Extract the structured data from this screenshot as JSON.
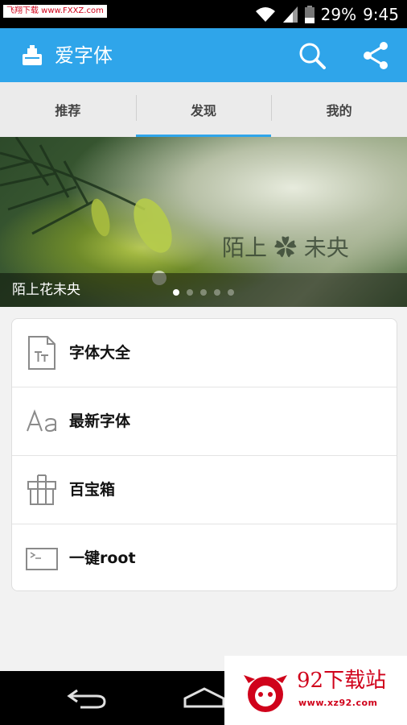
{
  "status_bar": {
    "watermark": "飞翔下载 www.FXXZ.com",
    "battery": "29%",
    "time": "9:45",
    "icons": [
      "wifi-icon",
      "signal-icon",
      "battery-icon"
    ]
  },
  "app_bar": {
    "title": "爱字体",
    "color": "#2fa5ea",
    "actions": [
      "search-icon",
      "share-icon"
    ]
  },
  "tabs": [
    {
      "label": "推荐",
      "active": false
    },
    {
      "label": "发现",
      "active": true
    },
    {
      "label": "我的",
      "active": false
    }
  ],
  "banner": {
    "caption": "陌上花未央",
    "image_text": "陌上 ✿ 未央",
    "page_count": 5,
    "current_page": 1
  },
  "menu": [
    {
      "label": "字体大全",
      "icon": "font-file-icon"
    },
    {
      "label": "最新字体",
      "icon": "text-aa-icon"
    },
    {
      "label": "百宝箱",
      "icon": "gift-box-icon"
    },
    {
      "label": "一键root",
      "icon": "terminal-icon"
    }
  ],
  "nav_bar": {
    "buttons": [
      "back-icon",
      "home-icon"
    ]
  },
  "ad_overlay": {
    "title": "92下载站",
    "url": "www.xz92.com"
  }
}
